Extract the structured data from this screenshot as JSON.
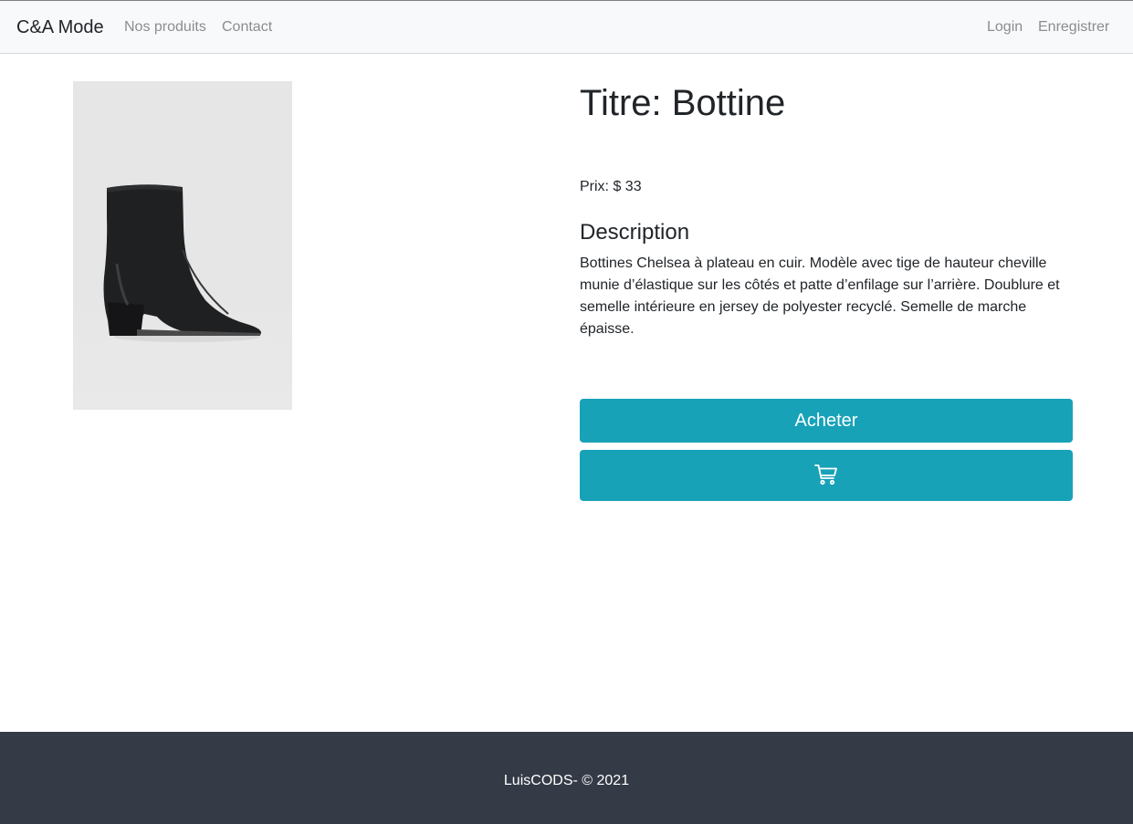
{
  "navbar": {
    "brand": "C&A Mode",
    "links": [
      "Nos produits",
      "Contact"
    ],
    "auth": [
      "Login",
      "Enregistrer"
    ]
  },
  "product": {
    "title": "Titre: Bottine",
    "price": "Prix: $ 33",
    "description_heading": "Description",
    "description": "Bottines Chelsea à plateau en cuir. Modèle avec tige de hauteur cheville munie d’élastique sur les côtés et patte d’enfilage sur l’arrière. Doublure et semelle intérieure en jersey de polyester recyclé. Semelle de marche épaisse.",
    "image_icon": "ankle-boot-photo"
  },
  "actions": {
    "buy_label": "Acheter",
    "cart_icon": "cart-icon"
  },
  "footer": {
    "text": "LuisCODS- © 2021"
  },
  "colors": {
    "accent": "#17a2b8",
    "navbar_bg": "#f8f9fa",
    "footer_bg": "#343a46"
  }
}
